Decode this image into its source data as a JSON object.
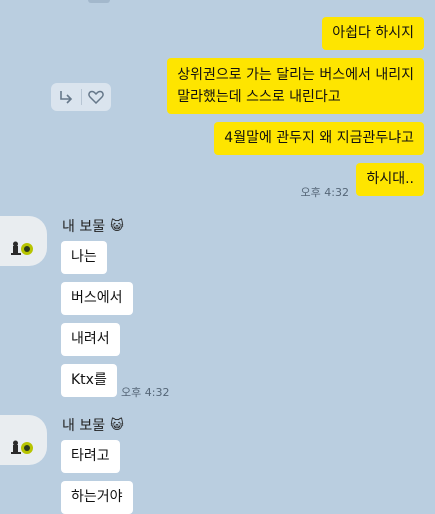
{
  "chat": {
    "sent": [
      {
        "text": "아쉽다 하시지"
      },
      {
        "text_line1": "상위권으로 가는 달리는 버스에서 내리지",
        "text_line2": "말라했는데 스스로 내린다고"
      },
      {
        "text": "4월말에 관두지 왜 지금관두냐고"
      },
      {
        "text": "하시대..",
        "time": "오후 4:32"
      }
    ],
    "groups": [
      {
        "sender": "내 보물",
        "sender_emoji": "😺",
        "messages": [
          "나는",
          "버스에서",
          "내려서",
          "Ktx를"
        ],
        "time": "오후 4:32"
      },
      {
        "sender": "내 보물",
        "sender_emoji": "😺",
        "messages": [
          "타려고",
          "하는거야"
        ]
      }
    ]
  },
  "colors": {
    "background": "#bacee0",
    "my_bubble": "#fee500",
    "their_bubble": "#ffffff"
  },
  "icons": {
    "reply": "reply-arrow-icon",
    "like": "heart-outline-icon"
  }
}
